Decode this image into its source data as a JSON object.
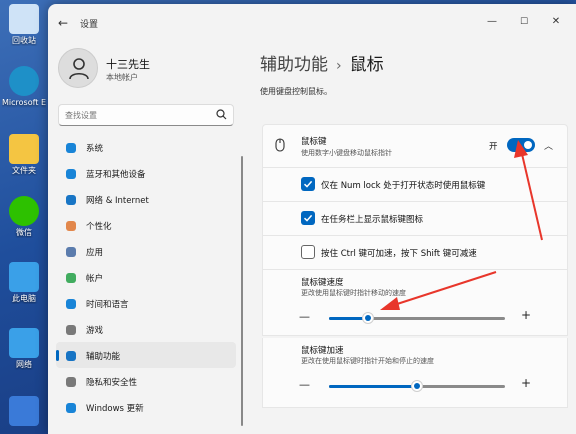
{
  "desktop": {
    "icons": [
      {
        "label": "回收站",
        "icon": "recycle-bin-icon",
        "color": "#cfe3f7"
      },
      {
        "label": "Microsoft Edge",
        "icon": "edge-icon",
        "color": "#1e90c8"
      },
      {
        "label": "文件夹",
        "icon": "folder-icon",
        "color": "#f4c542"
      },
      {
        "label": "微信",
        "icon": "wechat-icon",
        "color": "#2dc100"
      },
      {
        "label": "此电脑",
        "icon": "computer-icon",
        "color": "#3aa0e8"
      },
      {
        "label": "网络",
        "icon": "network-icon",
        "color": "#3aa0e8"
      },
      {
        "label": "",
        "icon": "control-panel-icon",
        "color": "#3a7ad8"
      }
    ]
  },
  "titlebar": {
    "title": "设置",
    "back_icon": "back-arrow-icon",
    "minimize": "—",
    "maximize": "☐",
    "close": "✕"
  },
  "profile": {
    "name": "十三先生",
    "account": "本地帐户"
  },
  "search": {
    "placeholder": "查找设置",
    "icon": "search-icon"
  },
  "nav": {
    "items": [
      {
        "label": "系统",
        "icon": "system-icon",
        "color": "#0078d4",
        "active": false
      },
      {
        "label": "蓝牙和其他设备",
        "icon": "bluetooth-icon",
        "color": "#0078d4",
        "active": false
      },
      {
        "label": "网络 & Internet",
        "icon": "wifi-icon",
        "color": "#0067c0",
        "active": false
      },
      {
        "label": "个性化",
        "icon": "brush-icon",
        "color": "#e07b39",
        "active": false
      },
      {
        "label": "应用",
        "icon": "apps-icon",
        "color": "#4a6fa5",
        "active": false
      },
      {
        "label": "帐户",
        "icon": "account-icon",
        "color": "#2ea44f",
        "active": false
      },
      {
        "label": "时间和语言",
        "icon": "globe-clock-icon",
        "color": "#0078d4",
        "active": false
      },
      {
        "label": "游戏",
        "icon": "gamepad-icon",
        "color": "#6b6b6b",
        "active": false
      },
      {
        "label": "辅助功能",
        "icon": "accessibility-icon",
        "color": "#0067c0",
        "active": true
      },
      {
        "label": "隐私和安全性",
        "icon": "shield-icon",
        "color": "#6b6b6b",
        "active": false
      },
      {
        "label": "Windows 更新",
        "icon": "update-icon",
        "color": "#0078d4",
        "active": false
      }
    ]
  },
  "main": {
    "breadcrumb": {
      "parent": "辅助功能",
      "separator": "›",
      "current": "鼠标"
    },
    "description": "使用键盘控制鼠标。",
    "mouse_keys": {
      "title": "鼠标键",
      "subtitle": "使用数字小键盘移动鼠标指针",
      "toggle_label": "开",
      "toggle_on": true,
      "icon": "mouse-icon",
      "expand_icon": "chevron-up-icon"
    },
    "options": [
      {
        "label": "仅在 Num lock 处于打开状态时使用鼠标键",
        "checked": true
      },
      {
        "label": "在任务栏上显示鼠标键图标",
        "checked": true
      },
      {
        "label": "按住 Ctrl 键可加速，按下 Shift 键可减速",
        "checked": false
      }
    ],
    "speed": {
      "title": "鼠标键速度",
      "subtitle": "更改使用鼠标键时指针移动的速度",
      "value": 0.22,
      "minus": "—",
      "plus": "+"
    },
    "acceleration": {
      "title": "鼠标键加速",
      "subtitle": "更改在使用鼠标键时指针开始和停止的速度",
      "value": 0.5,
      "minus": "—",
      "plus": "+"
    }
  },
  "accent_color": "#0067c0",
  "annotation_color": "#e8362b"
}
